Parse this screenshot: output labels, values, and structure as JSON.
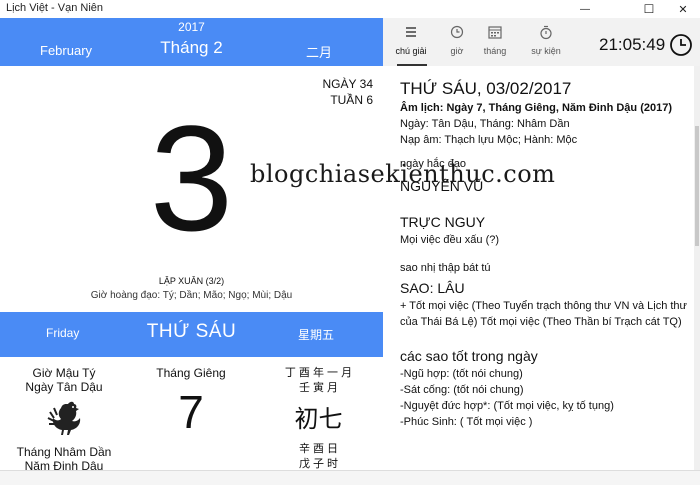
{
  "window": {
    "title": "Lịch Việt - Vạn Niên",
    "minimize_glyph": "—",
    "maximize_glyph": "☐",
    "close_glyph": "✕"
  },
  "left": {
    "year": "2017",
    "month_en": "February",
    "month_vi": "Tháng 2",
    "month_cn": "二月",
    "day_of_year": "NGÀY 34",
    "week": "TUẦN 6",
    "day_number": "3",
    "solar_term": "LẬP XUÂN (3/2)",
    "auspicious_hours": "Giờ hoàng đạo: Tý; Dần; Mão; Ngọ; Mùi; Dậu",
    "weekday_en": "Friday",
    "weekday_vi": "THỨ SÁU",
    "weekday_cn": "星期五",
    "col1": {
      "hour": "Giờ Mậu Tý",
      "day": "Ngày Tân Dậu",
      "month": "Tháng Nhâm Dần",
      "year": "Năm Đinh Dậu"
    },
    "col2": {
      "lunar_month": "Tháng Giêng",
      "lunar_day": "7"
    },
    "col3": {
      "year_month": "丁 酉 年   一 月",
      "month_ganzhi": "壬 寅 月",
      "day_cn": "初七",
      "day_ganzhi": "辛 酉 日",
      "hour_ganzhi": "戊 子 时"
    }
  },
  "toolbar": {
    "tabs": [
      "chú giải",
      "giờ",
      "tháng",
      "sự kiện"
    ],
    "clock": "21:05:49"
  },
  "detail": {
    "date_title": "THỨ SÁU, 03/02/2017",
    "lunar_line": "Âm lịch: Ngày 7, Tháng Giêng, Năm Đinh Dậu (2017)",
    "ganzhi": "Ngày: Tân Dậu, Tháng: Nhâm Dần",
    "napam": "Nạp âm: Thạch lựu Mộc; Hành: Mộc",
    "bad_day_label": "ngày hắc đạo",
    "bad_day_name": "NGUYÊN VŨ",
    "truc": "TRỰC NGUY",
    "truc_desc": "Mọi việc đều xấu (?)",
    "sao_label": "sao nhị thập bát tú",
    "sao_name": "SAO: LÂU",
    "sao_desc": "+ Tốt mọi việc (Theo Tuyển trạch thông thư VN và Lịch thư của Thái Bá Lệ) Tốt mọi việc (Theo Thần bí Trạch cát TQ)",
    "good_stars_title": "các sao tốt trong ngày",
    "good_stars": [
      "-Ngũ hợp: (tốt nói chung)",
      "-Sát cống: (tốt nói chung)",
      "-Nguyệt đức hợp*: (Tốt mọi việc, kỵ tố tụng)",
      "-Phúc Sinh: ( Tốt mọi việc )"
    ]
  },
  "watermark": "blogchiasekienthuc.com"
}
